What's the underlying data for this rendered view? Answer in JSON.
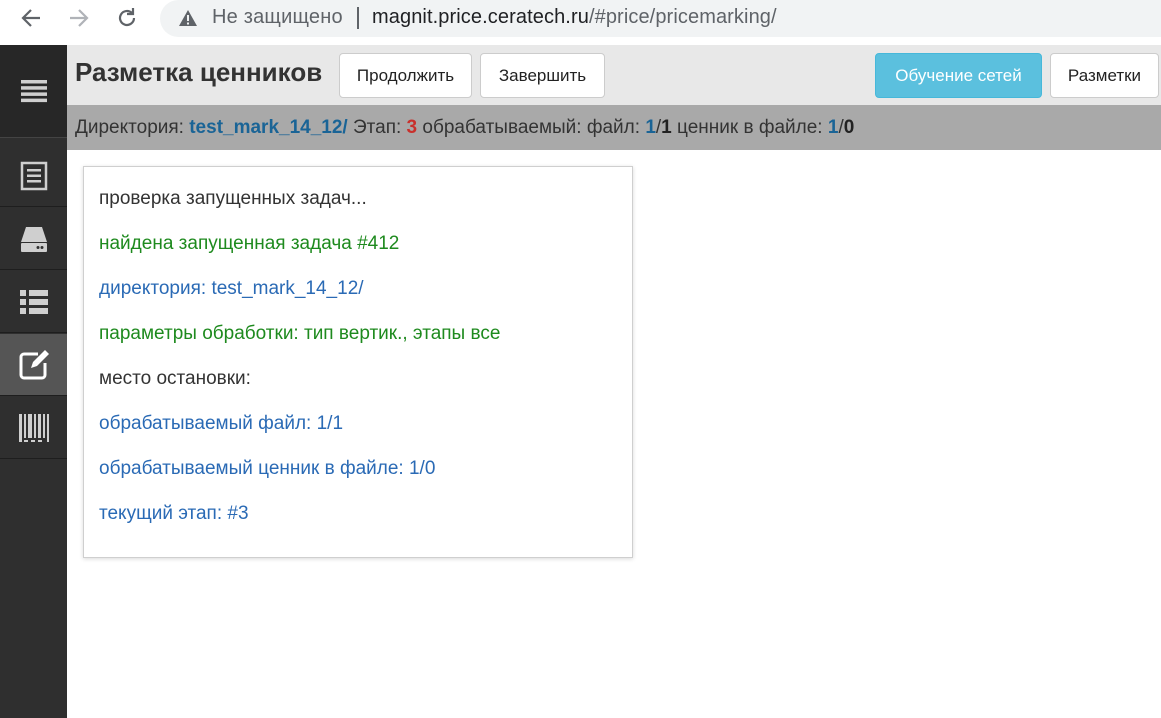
{
  "browser": {
    "security_text": "Не защищено",
    "url_host": "magnit.price.ceratech.ru",
    "url_path": "/#price/pricemarking/"
  },
  "header": {
    "title": "Разметка ценников",
    "continue_label": "Продолжить",
    "finish_label": "Завершить",
    "train_label": "Обучение сетей",
    "markups_label": "Разметки"
  },
  "infobar": {
    "dir_label": "Директория: ",
    "dir_value": "test_mark_14_12/",
    "stage_label": " Этап: ",
    "stage_value": "3",
    "processing_label": " обрабатываемый: файл: ",
    "file_current": "1",
    "file_sep": "/",
    "file_total": "1",
    "tag_label": " ценник в файле: ",
    "tag_current": "1",
    "tag_sep": "/",
    "tag_total": "0"
  },
  "log": [
    {
      "text": "проверка запущенных задач...",
      "color": "#333333"
    },
    {
      "text": "найдена запущенная задача #412",
      "color": "#1e8a1e"
    },
    {
      "text": "директория: test_mark_14_12/",
      "color": "#2a6ab5"
    },
    {
      "text": "параметры обработки: тип вертик., этапы все",
      "color": "#1e8a1e"
    },
    {
      "text": "место остановки:",
      "color": "#333333"
    },
    {
      "text": "обрабатываемый файл: 1/1",
      "color": "#2a6ab5"
    },
    {
      "text": "обрабатываемый ценник в файле: 1/0",
      "color": "#2a6ab5"
    },
    {
      "text": "текущий этап: #3",
      "color": "#2a6ab5"
    }
  ],
  "sidebar": {
    "items": [
      {
        "icon": "menu-icon"
      },
      {
        "icon": "document-list-icon"
      },
      {
        "icon": "drive-icon"
      },
      {
        "icon": "list-icon"
      },
      {
        "icon": "edit-icon"
      },
      {
        "icon": "barcode-icon"
      }
    ]
  },
  "colors": {
    "sidebar_bg": "#2f2f2f",
    "sidebar_active": "#555555",
    "header_bg": "#e8e8e8",
    "infobar_bg": "#a9a9a9",
    "info_button": "#5bc0de"
  }
}
